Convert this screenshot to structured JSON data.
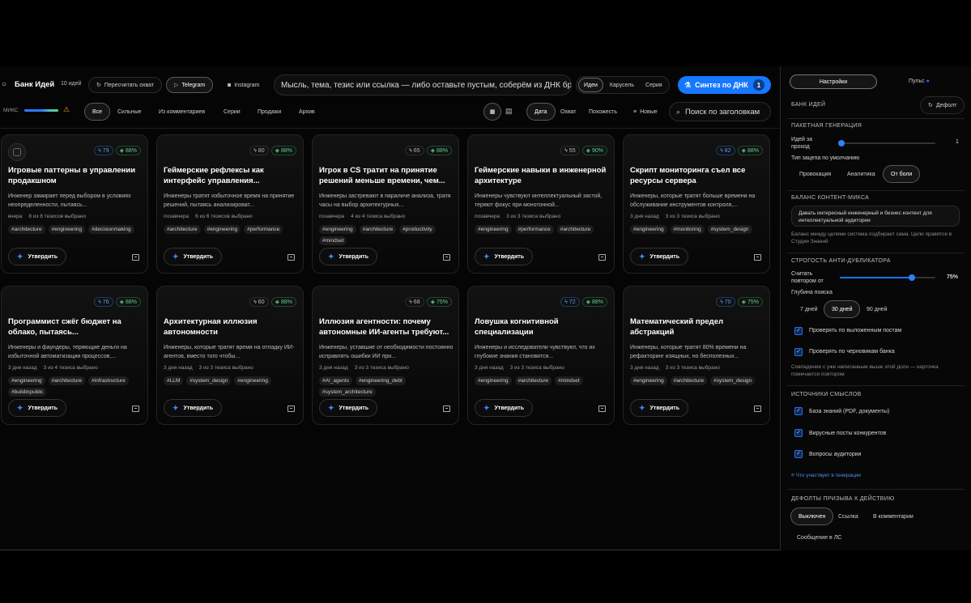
{
  "header": {
    "title": "Банк Идей",
    "count": "10 идей",
    "recount": "Пересчитать охват",
    "tab_telegram": "Telegram",
    "tab_instagram": "Instagram",
    "search_placeholder": "Мысль, тема, тезис или ссылка — либо оставьте пустым, соберём из ДНК бренда",
    "mode_ideas": "Идеи",
    "mode_carousel": "Карусель",
    "mode_series": "Серия",
    "synth_label": "Синтез по ДНК",
    "synth_count": "1"
  },
  "mix": {
    "label": "МИКС",
    "warn": "⚠"
  },
  "filters": [
    "Все",
    "Сильные",
    "Из комментариев",
    "Серии",
    "Продажи",
    "Архив"
  ],
  "sort": {
    "date": "Дата",
    "reach": "Охват",
    "similar": "Похожесть",
    "newest": "Новые",
    "search_placeholder": "Поиск по заголовкам"
  },
  "cards": [
    {
      "score": "79",
      "match": "88%",
      "title": "Игровые паттерны в управлении продакшном",
      "desc": "Инженер замирает перед выбором в условиях неопределенности, пытаясь...",
      "time": "вчера",
      "thesis": "8 из 8 тезисов выбрано",
      "tags": [
        "#architecture",
        "#engineering",
        "#decisionmaking"
      ]
    },
    {
      "score": "80",
      "match": "88%",
      "title": "Геймерские рефлексы как интерфейс управления...",
      "desc": "Инженеры тратят избыточное время на принятие решений, пытаясь анализироват...",
      "time": "позавчера",
      "thesis": "6 из 6 тезисов выбрано",
      "tags": [
        "#architecture",
        "#engineering",
        "#performance"
      ]
    },
    {
      "score": "65",
      "match": "88%",
      "title": "Игрок в CS тратит на принятие решений меньше времени, чем...",
      "desc": "Инженеры застревают в параличе анализа, тратя часы на выбор архитектурных...",
      "time": "позавчера",
      "thesis": "4 из 4 тезиса выбрано",
      "tags": [
        "#engineering",
        "#architecture",
        "#productivity",
        "#mindset"
      ]
    },
    {
      "score": "55",
      "match": "90%",
      "title": "Геймерские навыки в инженерной архитектуре",
      "desc": "Инженеры чувствуют интеллектуальный застой, теряют фокус при монотонной...",
      "time": "позавчера",
      "thesis": "3 из 3 тезиса выбрано",
      "tags": [
        "#engineering",
        "#performance",
        "#architecture"
      ]
    },
    {
      "score": "82",
      "match": "88%",
      "title": "Скрипт мониторинга съел все ресурсы сервера",
      "desc": "Инженеры, которые тратят больше времени на обслуживание инструментов контроля,...",
      "time": "3 дня назад",
      "thesis": "3 из 3 тезиса выбрано",
      "tags": [
        "#engineering",
        "#monitoring",
        "#system_design"
      ]
    },
    {
      "score": "76",
      "match": "88%",
      "title": "Программист сжёг бюджет на облако, пытаясь...",
      "desc": "Инженеры и фаундеры, теряющие деньги на избыточной автоматизации процессов,...",
      "time": "3 дня назад",
      "thesis": "3 из 4 тезиса выбрано",
      "tags": [
        "#engineering",
        "#architecture",
        "#infrastructure",
        "#buildinpublic"
      ]
    },
    {
      "score": "60",
      "match": "88%",
      "title": "Архитектурная иллюзия автономности",
      "desc": "Инженеры, которые тратят время на отладку ИИ-агентов, вместо того чтобы...",
      "time": "3 дня назад",
      "thesis": "3 из 3 тезиса выбрано",
      "tags": [
        "#LLM",
        "#system_design",
        "#engineering"
      ]
    },
    {
      "score": "68",
      "match": "75%",
      "title": "Иллюзия агентности: почему автономные ИИ-агенты требуют...",
      "desc": "Инженеры, уставшие от необходимости постоянно исправлять ошибки ИИ при...",
      "time": "3 дня назад",
      "thesis": "3 из 3 тезиса выбрано",
      "tags": [
        "#AI_agents",
        "#engineering_debt",
        "#system_architecture"
      ]
    },
    {
      "score": "72",
      "match": "88%",
      "title": "Ловушка когнитивной специализации",
      "desc": "Инженеры и исследователи чувствуют, что их глубокие знания становятся...",
      "time": "3 дня назад",
      "thesis": "3 из 3 тезиса выбрано",
      "tags": [
        "#engineering",
        "#architecture",
        "#mindset"
      ]
    },
    {
      "score": "70",
      "match": "75%",
      "title": "Математический предел абстракций",
      "desc": "Инженеры, которые тратят 80% времени на рефакторинг изящных, но бесполезных...",
      "time": "3 дня назад",
      "thesis": "3 из 3 тезиса выбрано",
      "tags": [
        "#engineering",
        "#architecture",
        "#system_design"
      ]
    }
  ],
  "approve_label": "Утвердить",
  "side": {
    "tab_settings": "Настройки",
    "tab_pulse": "Пульс",
    "bank": "БАНК ИДЕЙ",
    "default_btn": "Дефолт",
    "batch": "ПАКЕТНАЯ ГЕНЕРАЦИЯ",
    "ideas_per_pass": "Идей за проход",
    "ideas_per_pass_value": "1",
    "hook_type": "Тип зацепа по умолчанию",
    "hooks": [
      "Провокация",
      "Аналитика",
      "От боли"
    ],
    "balance": "БАЛАНС КОНТЕНТ-МИКСА",
    "balance_text": "Давать интересный инженерный и бизнес контент для интеллектуальной аудитории",
    "balance_note": "Баланс между целями система подбирает сама. Цели правятся в Студии Знаний",
    "dedup": "СТРОГОСТЬ АНТИ-ДУБЛИКАТОРА",
    "repeat_from": "Считать повтором от",
    "repeat_value": "75%",
    "repeat_level": 0.75,
    "depth": "Глубина поиска",
    "depth_opts": [
      "7 дней",
      "30 дней",
      "90 дней"
    ],
    "check_posted": "Проверять по выложенным постам",
    "check_drafts": "Проверять по черновикам банка",
    "dedup_note": "Совпадение с уже написанным выше этой доли — карточка помечается повтором",
    "sources": "ИСТОЧНИКИ СМЫСЛОВ",
    "source_items": [
      "База знаний (PDF, документы)",
      "Вирусные посты конкурентов",
      "Вопросы аудитории"
    ],
    "who_link": "Что участвует в генерации",
    "cta": "ДЕФОЛТЫ ПРИЗЫВА К ДЕЙСТВИЮ",
    "cta_opts": [
      "Выключен",
      "Ссылка",
      "В комментарии",
      "Сообщение в ЛС"
    ]
  },
  "colors": {
    "accent": "#1677ff",
    "green": "#5fd38c"
  }
}
